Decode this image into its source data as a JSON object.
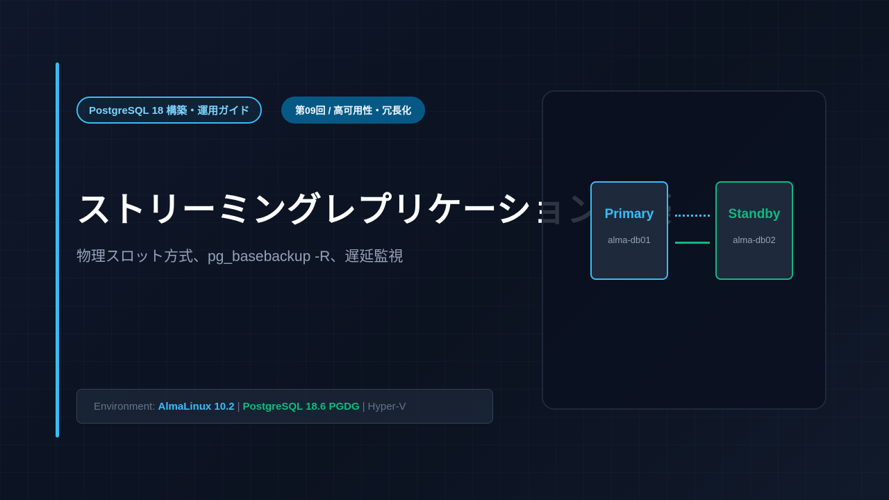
{
  "header": {
    "series_badge": "PostgreSQL 18 構築・運用ガイド",
    "episode_badge": "第09回 / 高可用性・冗長化"
  },
  "title": "ストリーミングレプリケーション構築",
  "subtitle": "物理スロット方式、pg_basebackup -R、遅延監視",
  "environment": {
    "label": "Environment:",
    "os": "AlmaLinux 10.2",
    "separator": "|",
    "postgres": "PostgreSQL 18.6 PGDG",
    "hypervisor": "Hyper-V"
  },
  "diagram": {
    "primary": {
      "title": "Primary",
      "host": "alma-db01"
    },
    "standby": {
      "title": "Standby",
      "host": "alma-db02"
    }
  },
  "colors": {
    "background": "#0f172a",
    "accent_blue": "#38bdf8",
    "accent_green": "#10b981",
    "badge_dark_blue": "#075985",
    "muted_text": "#94a3b8"
  }
}
